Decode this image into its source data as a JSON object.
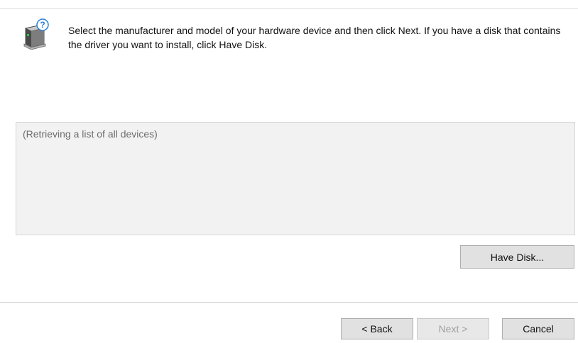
{
  "header": {
    "icon": "hardware-device-question-icon",
    "instructions": "Select the manufacturer and model of your hardware device and then click Next. If you have a disk that contains the driver you want to install, click Have Disk."
  },
  "device_list": {
    "status_text": "(Retrieving a list of all devices)"
  },
  "buttons": {
    "have_disk": "Have Disk...",
    "back": "< Back",
    "next": "Next >",
    "cancel": "Cancel"
  },
  "colors": {
    "list_background": "#f2f2f2",
    "button_face": "#e1e1e1",
    "disabled_text": "#a0a0a0",
    "question_badge": "#2a7fd6"
  }
}
